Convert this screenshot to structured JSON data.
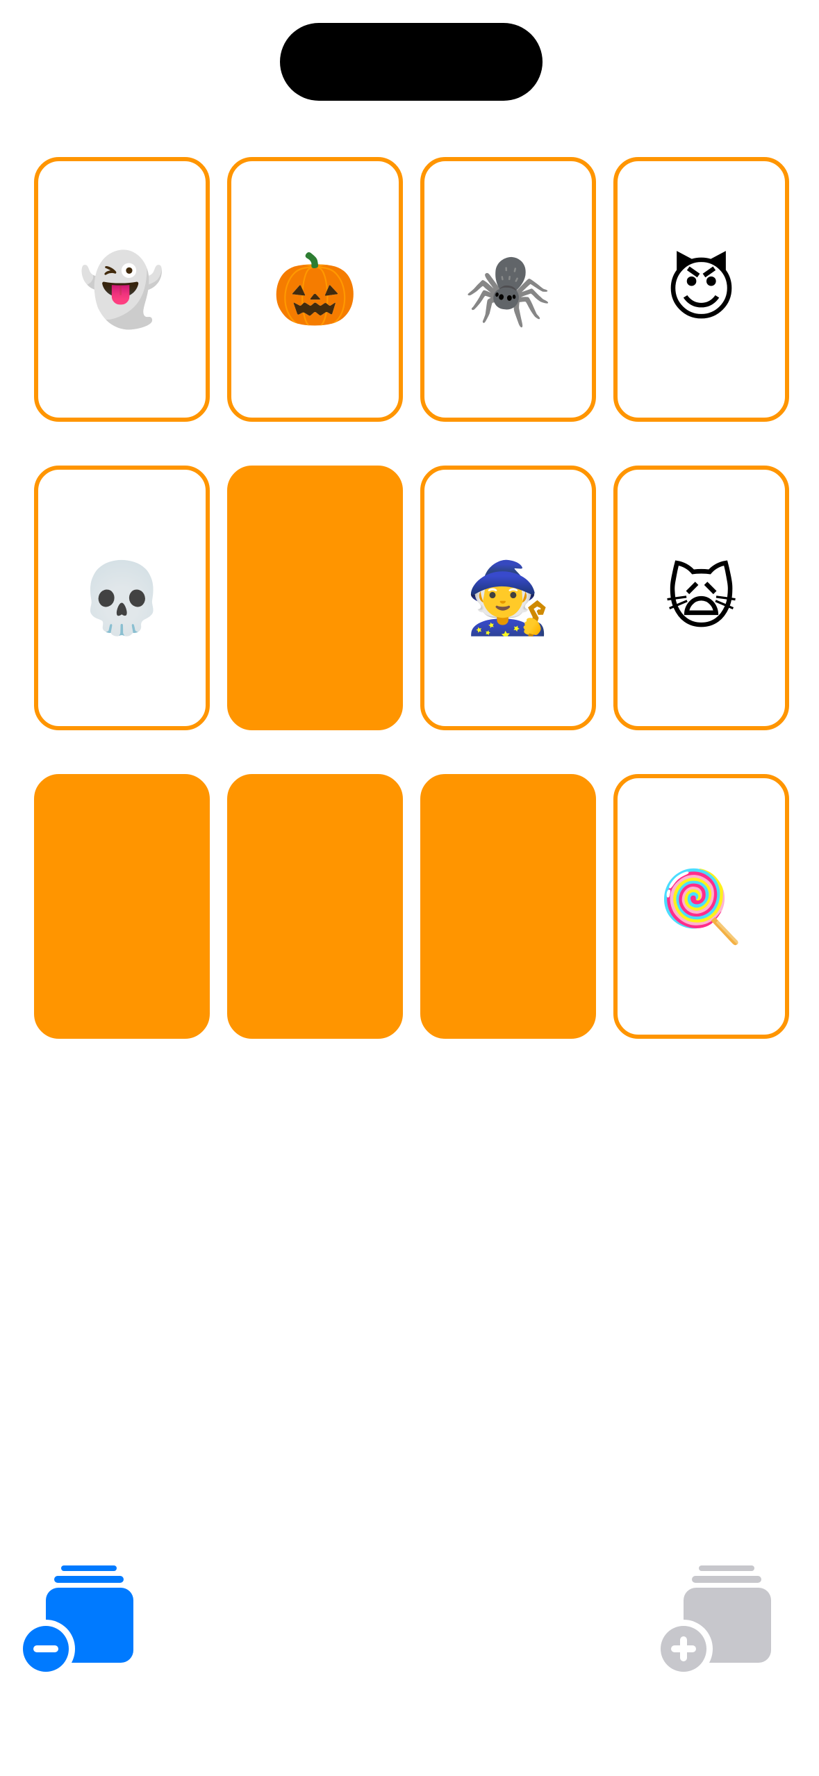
{
  "theme": {
    "card_color": "#ff9500",
    "remove_color": "#007aff",
    "add_color": "#c7c7cc"
  },
  "cards": [
    {
      "emoji": "👻",
      "face_up": true
    },
    {
      "emoji": "🎃",
      "face_up": true
    },
    {
      "emoji": "🕷️",
      "face_up": true
    },
    {
      "emoji": "😈",
      "face_up": true
    },
    {
      "emoji": "💀",
      "face_up": true
    },
    {
      "emoji": "",
      "face_up": false
    },
    {
      "emoji": "🧙",
      "face_up": true
    },
    {
      "emoji": "🙀",
      "face_up": true
    },
    {
      "emoji": "",
      "face_up": false
    },
    {
      "emoji": "",
      "face_up": false
    },
    {
      "emoji": "",
      "face_up": false
    },
    {
      "emoji": "🍭",
      "face_up": true
    }
  ],
  "toolbar": {
    "remove_icon": "rectangle-stack-badge-minus-icon",
    "add_icon": "rectangle-stack-badge-plus-icon"
  }
}
